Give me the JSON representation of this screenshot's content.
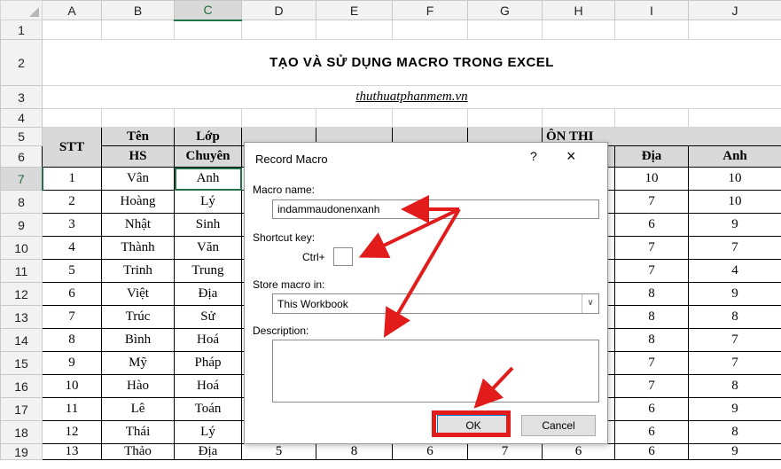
{
  "spreadsheet": {
    "columns": [
      "A",
      "B",
      "C",
      "D",
      "E",
      "F",
      "G",
      "H",
      "I",
      "J"
    ],
    "rows": [
      "1",
      "2",
      "3",
      "4",
      "5",
      "6",
      "7",
      "8",
      "9",
      "10",
      "11",
      "12",
      "13",
      "14",
      "15",
      "16",
      "17",
      "18",
      "19"
    ],
    "title": "TẠO VÀ SỬ DỤNG MACRO TRONG EXCEL",
    "website": "thuthuatphanmem.vn",
    "header": {
      "stt": "STT",
      "ten_hs": [
        "Tên",
        "HS"
      ],
      "lop_chuyen": [
        "Lớp",
        "Chuyên"
      ],
      "group_fragment": "ÔN THI",
      "dia": "Địa",
      "anh": "Anh"
    },
    "students": [
      {
        "stt": "1",
        "ten": "Vân",
        "lop": "Anh",
        "dia": "10",
        "anh": "10"
      },
      {
        "stt": "2",
        "ten": "Hoàng",
        "lop": "Lý",
        "dia": "7",
        "anh": "10"
      },
      {
        "stt": "3",
        "ten": "Nhật",
        "lop": "Sinh",
        "dia": "6",
        "anh": "9"
      },
      {
        "stt": "4",
        "ten": "Thành",
        "lop": "Văn",
        "dia": "7",
        "anh": "7"
      },
      {
        "stt": "5",
        "ten": "Trinh",
        "lop": "Trung",
        "dia": "7",
        "anh": "4"
      },
      {
        "stt": "6",
        "ten": "Việt",
        "lop": "Địa",
        "dia": "8",
        "anh": "9"
      },
      {
        "stt": "7",
        "ten": "Trúc",
        "lop": "Sử",
        "dia": "8",
        "anh": "8"
      },
      {
        "stt": "8",
        "ten": "Bình",
        "lop": "Hoá",
        "dia": "8",
        "anh": "7"
      },
      {
        "stt": "9",
        "ten": "Mỹ",
        "lop": "Pháp",
        "dia": "7",
        "anh": "7"
      },
      {
        "stt": "10",
        "ten": "Hào",
        "lop": "Hoá",
        "dia": "7",
        "anh": "8"
      },
      {
        "stt": "11",
        "ten": "Lê",
        "lop": "Toán",
        "dia": "6",
        "anh": "9"
      },
      {
        "stt": "12",
        "ten": "Thái",
        "lop": "Lý",
        "dia": "6",
        "anh": "8"
      },
      {
        "stt": "13",
        "ten": "Thảo",
        "lop": "Địa",
        "d": "5",
        "e": "8",
        "f": "6",
        "g": "7",
        "h": "6",
        "dia": "6",
        "anh": "9"
      }
    ]
  },
  "dialog": {
    "title": "Record Macro",
    "help_glyph": "?",
    "close_glyph": "×",
    "macro_name_label": "Macro name:",
    "macro_name_value": "indammaudonenxanh",
    "shortcut_label": "Shortcut key:",
    "ctrl_label": "Ctrl+",
    "store_label": "Store macro in:",
    "store_value": "This Workbook",
    "dropdown_glyph": "∨",
    "description_label": "Description:",
    "ok_label": "OK",
    "cancel_label": "Cancel"
  },
  "annotation_color": "#e21b1b",
  "accent_color": "#217346"
}
